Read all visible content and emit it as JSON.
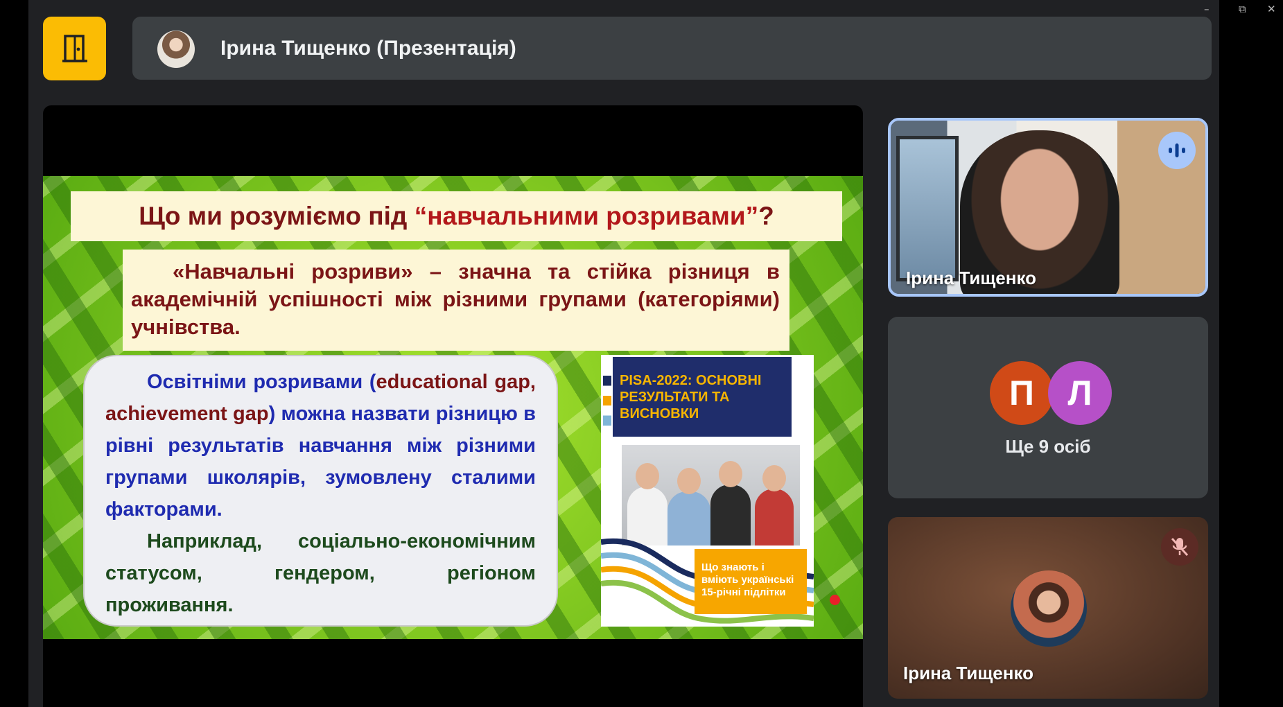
{
  "window": {
    "minimize": "–",
    "restore": "⧉",
    "close": "✕"
  },
  "header": {
    "presenter_title": "Ірина Тищенко (Презентація)"
  },
  "slide": {
    "title_prefix": "Що ми розуміємо під ",
    "title_quoted": "“навчальними розривами”",
    "title_suffix": "?",
    "definition": "«Навчальні розриви» – значна та стійка різниця в академічній успішності між різними групами (категоріями) учнівства.",
    "edu_p1_a": "Освітніми розривами (",
    "edu_p1_b": "educational gap, achievement gap",
    "edu_p1_c": ") можна назвати різницю в рівні результатів навчання між різними групами школярів, зумовлену сталими факторами.",
    "edu_p2": "Наприклад, соціально-економічним статусом, гендером, регіоном проживання.",
    "pisa_title": "PISA-2022: ОСНОВНІ РЕЗУЛЬТАТИ ТА ВИСНОВКИ",
    "pisa_cta": "Що знають і вміють українські 15-річні підлітки"
  },
  "participants": {
    "speaker_name": "Ірина Тищенко",
    "avatar_1_letter": "П",
    "avatar_2_letter": "Л",
    "others_label": "Ще 9 осіб",
    "self_name": "Ірина Тищенко"
  },
  "colors": {
    "accent": "#fbbc04",
    "speaking": "#a8c7fa",
    "avatar_p": "#d04a17",
    "avatar_l": "#b650c8"
  }
}
